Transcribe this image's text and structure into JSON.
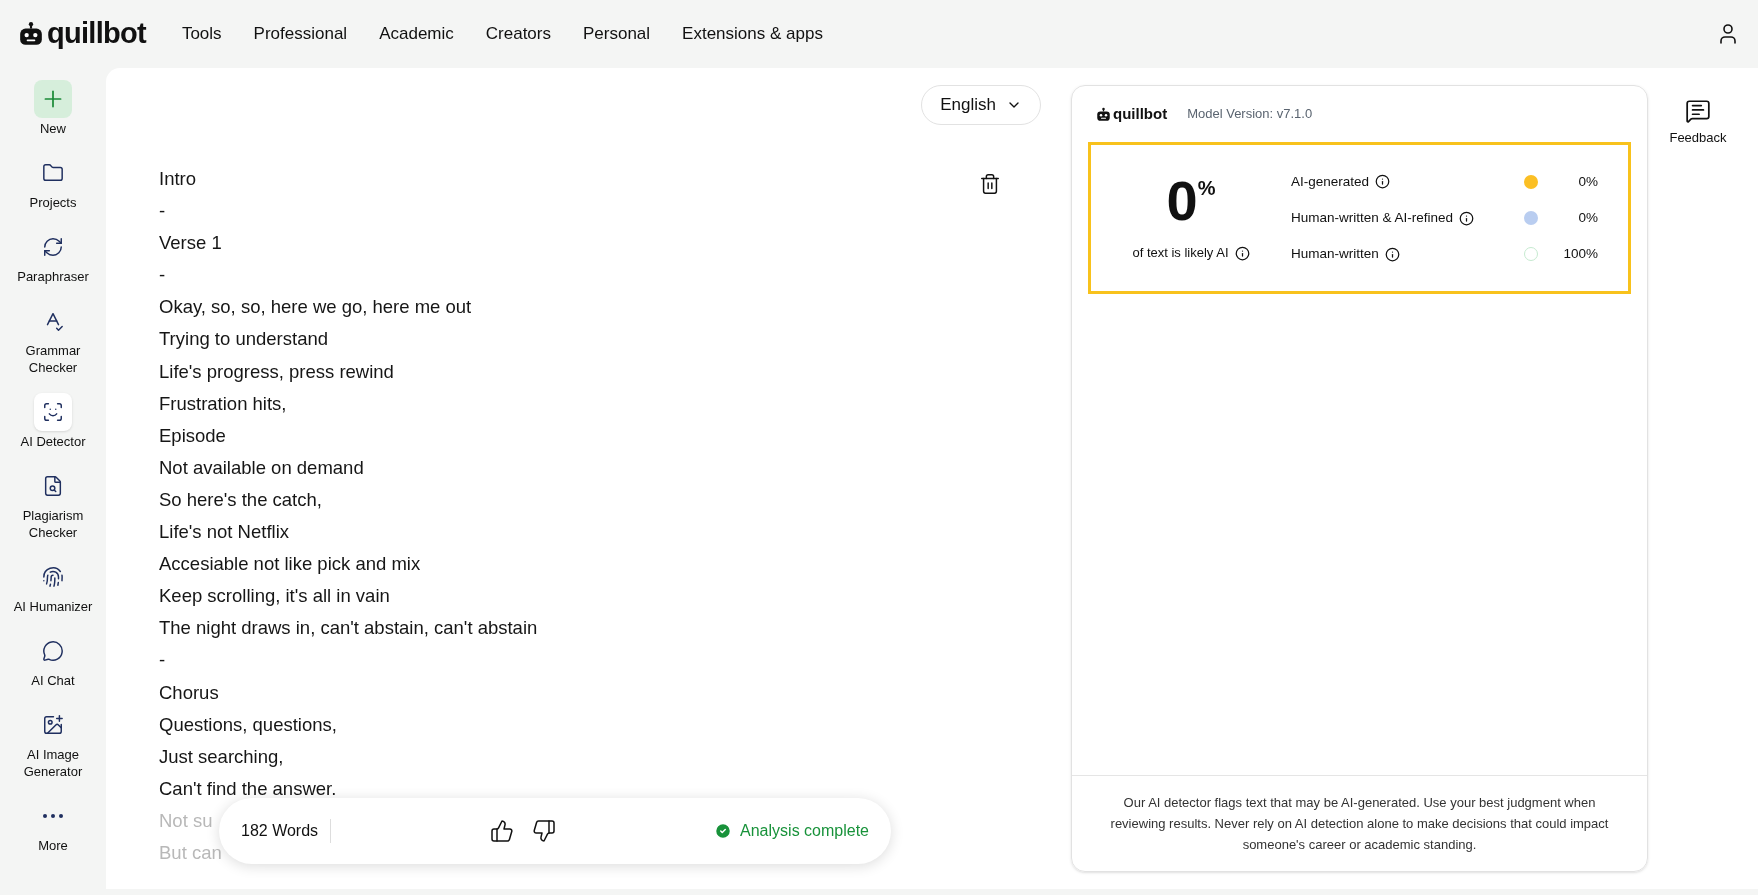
{
  "header": {
    "logo": "quillbot",
    "nav": [
      "Tools",
      "Professional",
      "Academic",
      "Creators",
      "Personal",
      "Extensions & apps"
    ]
  },
  "sidebar": {
    "items": [
      {
        "label": "New",
        "kind": "new",
        "selected": false
      },
      {
        "label": "Projects",
        "kind": "tool",
        "selected": false
      },
      {
        "label": "Paraphraser",
        "kind": "tool",
        "selected": false
      },
      {
        "label": "Grammar Checker",
        "kind": "tool",
        "selected": false
      },
      {
        "label": "AI Detector",
        "kind": "tool",
        "selected": true
      },
      {
        "label": "Plagiarism Checker",
        "kind": "tool",
        "selected": false
      },
      {
        "label": "AI Humanizer",
        "kind": "tool",
        "selected": false
      },
      {
        "label": "AI Chat",
        "kind": "tool",
        "selected": false
      },
      {
        "label": "AI Image Generator",
        "kind": "tool",
        "selected": false
      },
      {
        "label": "More",
        "kind": "more",
        "selected": false
      }
    ]
  },
  "editor": {
    "language": "English",
    "lines": [
      {
        "text": "Intro",
        "faded": false
      },
      {
        "text": "-",
        "faded": false
      },
      {
        "text": "Verse 1",
        "faded": false
      },
      {
        "text": "-",
        "faded": false
      },
      {
        "text": "Okay, so, so, here we go, here me out",
        "faded": false
      },
      {
        "text": "Trying to understand",
        "faded": false
      },
      {
        "text": "Life's progress, press rewind",
        "faded": false
      },
      {
        "text": "Frustration hits,",
        "faded": false
      },
      {
        "text": "Episode",
        "faded": false
      },
      {
        "text": "Not available on demand",
        "faded": false
      },
      {
        "text": "So here's the catch,",
        "faded": false
      },
      {
        "text": "Life's not Netflix",
        "faded": false
      },
      {
        "text": "Accesiable not like pick and mix",
        "faded": false
      },
      {
        "text": "Keep scrolling, it's all in vain",
        "faded": false
      },
      {
        "text": "The night draws in, can't abstain, can't abstain",
        "faded": false
      },
      {
        "text": "-",
        "faded": false
      },
      {
        "text": "Chorus",
        "faded": false
      },
      {
        "text": "Questions, questions,",
        "faded": false
      },
      {
        "text": "Just searching,",
        "faded": false
      },
      {
        "text": "Can't find the answer.",
        "faded": false
      },
      {
        "text": "Not su",
        "faded": true
      },
      {
        "text": "But can",
        "faded": true
      }
    ],
    "footer": {
      "word_count": "182 Words",
      "status": "Analysis complete"
    }
  },
  "results": {
    "logo": "quillbot",
    "model_version": "Model Version: v7.1.0",
    "score": "0",
    "score_unit": "%",
    "score_caption": "of text is likely AI",
    "categories": [
      {
        "label": "AI-generated",
        "value": "0%",
        "color": "#fbbf24",
        "kind": "filled"
      },
      {
        "label": "Human-written & AI-refined",
        "value": "0%",
        "color": "#b9cdf0",
        "kind": "filled"
      },
      {
        "label": "Human-written",
        "value": "100%",
        "color": "#c6ead0",
        "kind": "ring"
      }
    ],
    "disclaimer": "Our AI detector flags text that may be AI-generated. Use your best judgment when reviewing results. Never rely on AI detection alone to make decisions that could impact someone's career or academic standing."
  },
  "feedback": {
    "label": "Feedback"
  }
}
